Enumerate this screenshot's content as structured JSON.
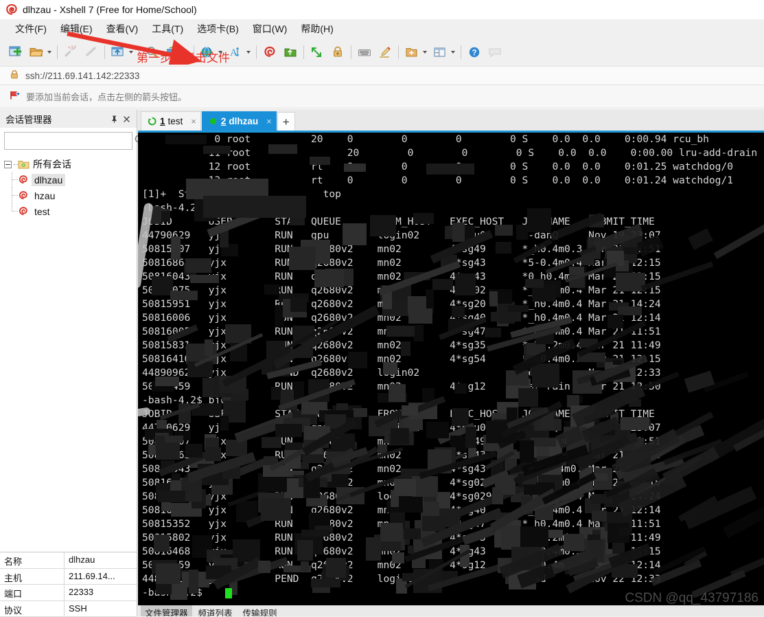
{
  "window": {
    "title": "dlhzau - Xshell 7 (Free for Home/School)",
    "app_icon": "xshell-spiral-icon"
  },
  "menubar": {
    "items": [
      {
        "label": "文件(F)",
        "name": "menu-file"
      },
      {
        "label": "编辑(E)",
        "name": "menu-edit"
      },
      {
        "label": "查看(V)",
        "name": "menu-view"
      },
      {
        "label": "工具(T)",
        "name": "menu-tools"
      },
      {
        "label": "选项卡(B)",
        "name": "menu-tabs"
      },
      {
        "label": "窗口(W)",
        "name": "menu-window"
      },
      {
        "label": "帮助(H)",
        "name": "menu-help"
      }
    ]
  },
  "toolbar": {
    "icons": [
      "new-session-icon",
      "open-session-icon",
      "disconnect-icon",
      "reconnect-icon",
      "transfer-file-icon",
      "find-icon",
      "copy-paste-icon",
      "globe-icon",
      "font-size-icon",
      "xshell-icon",
      "xftp-icon",
      "fullscreen-icon",
      "lock-icon",
      "keyboard-icon",
      "highlight-icon",
      "new-folder-icon",
      "layout-icon",
      "help-icon",
      "chat-icon"
    ]
  },
  "address": {
    "lock_icon": "lock-icon",
    "url": "ssh://211.69.141.142:22333"
  },
  "hint": {
    "icon": "flag-icon",
    "text": "要添加当前会话，点击左侧的箭头按钮。"
  },
  "session_manager": {
    "title": "会话管理器",
    "pin_icon": "pin-icon",
    "close_icon": "close-icon",
    "search": {
      "value": "",
      "placeholder": "",
      "icon": "search-icon"
    },
    "root": {
      "label": "所有会话",
      "icon": "folder-icon"
    },
    "sessions": [
      {
        "label": "dlhzau",
        "icon": "xshell-session-icon",
        "selected": true
      },
      {
        "label": "hzau",
        "icon": "xshell-session-icon",
        "selected": false
      },
      {
        "label": "test",
        "icon": "xshell-session-icon",
        "selected": false
      }
    ]
  },
  "properties": {
    "rows": [
      {
        "key": "名称",
        "value": "dlhzau"
      },
      {
        "key": "主机",
        "value": "211.69.14..."
      },
      {
        "key": "端口",
        "value": "22333"
      },
      {
        "key": "协议",
        "value": "SSH"
      }
    ]
  },
  "tabs": {
    "items": [
      {
        "num": "1",
        "name": "test",
        "icon": "reconnect-icon",
        "active": false,
        "close": "×"
      },
      {
        "num": "2",
        "name": "dlhzau",
        "icon": "connected-dot-icon",
        "active": true,
        "close": "×"
      }
    ],
    "add_label": "+"
  },
  "terminal": {
    "lines": [
      "            0 root          20    0        0        0        0 S    0.0  0.0    0:00.94 rcu_bh",
      "           11 root                20        0        0        0 S    0.0  0.0    0:00.00 lru-add-drain",
      "           12 root          rt    0        0        0        0 S    0.0  0.0    0:01.25 watchdog/0",
      "           13 root          rt    0        0        0        0 S    0.0  0.0    0:01.24 watchdog/1",
      "[1]+  Stopped                 top",
      "-bash-4.2$ bjobs",
      "JOBID      USER       STAT  QUEUE      FROM_HOST   EXEC_HOST   JOB_NAME   SUBMIT_TIME",
      "44790629   yjx        RUN   gpu        login02     4*gpu02     8-danQ     Nov 19 23:07",
      "50815807   yjx        RUN   q2680v2    mn02        4*sg49      *_h0.4m0.3 Mar 21 11:51",
      "50816863   yjx        RUN   q2680v2    mn02        4*sg43      *5-0.4m0.4 Mar 21 12:15",
      "50816043   yjx        RUN   q2680v2    mn02        4*sg43      *0_h0.4m0. Mar 21 12:15",
      "50816075   yjx        RUN   q2680v2    mn02        4*sg02      *_0.02m0.4 Mar 21 12:15",
      "50815951   yjx        RUN   q2680v2    mn02        4*sg20      *_h0.4m0.4 Mar 21 14:24",
      "50816006   yjx        RUN   q2680v2    mn02        4*sg40      *_h0.4m0.4 Mar 21 12:14",
      "50816005   yjx        RUN   q2680v2    mn02        4*sg47      *_h0.4m0.4 Mar 21 11:51",
      "50815831   yjx        RUN   q2680v2    mn02        4*sg35      *_h0.2m0.4 Mar 21 11:49",
      "50816410   yjx        RUN   q2680v2    mn02        4*sg54      *5-0.4m0.3 Mar 21 12:15",
      "44890962   yjx        PEND  q2680v2    login02                 read       Nov 22 12:33",
      "50816459   yjx        RUN   q2680v2    mn02        4*sg12      ear rain   Mar 21 12:50",
      "-bash-4.2$ bjobs",
      "JOBID      USER       STAT  QUEUE      FROM_HOST   EXEC_HOST   JOB_NAME   SUBMIT_TIME",
      "44790629   yjx        RUN   gpu        login02     4*gpu02     8-danQ     Nov 19 23:07",
      "50815807   yjx        RUN   q2680v2    mn02        4*sg49      *_h0.4m0.3 Mar 21 11:51",
      "50816863   yjx        RUN   q2680v2    mn02        4*sg43      *5-0.4m0.4 Mar 21 12:15",
      "50816043   yjx        RUN   q2680v2    mn02        4*sg43      *0_h0.4m0. Mar 21 12:15",
      "50816075   yjx        RUN   q2680v2    mn02        4*sg02      *_0.02m0.4 Mar 21 12:15",
      "50826091   yjx        RUN   q2680v2    login02     4*sg029     *_h0.4m0.4 Mar 21 14:24",
      "50816812   yjx        RUN   q2680v2    mn02        4*sg40      *_h0.4m0.4 Mar 21 12:14",
      "50815352   yjx        RUN   q2680v2    mn02        4*sg47      *_h0.4m0.4 Mar 21 11:51",
      "50815802   yjx        RUN   q2680v2    mn02        4*sg35      *_h0.2m0.4 Mar 21 11:49",
      "50816468   yjx        RUN   q2680v2    mn02        4*sg43      *5-0.4m0.3 Mar 21 12:15",
      "50816459   yjx        RUN   q2680v2    mn02        4*sg12      *_h0.4m0.4 Mar 21 12:14",
      "44890962   yjx        PEND  q2680v2    login02                 read       Nov 22 12:33",
      "-bash-4.2$ "
    ],
    "prompt": "-bash-4.2$",
    "cursor": "block-cursor"
  },
  "bottom_tabs": {
    "items": [
      {
        "label": "文件管理器",
        "active": true
      },
      {
        "label": "频道列表",
        "active": false
      },
      {
        "label": "传输规则",
        "active": false
      }
    ]
  },
  "annotation": {
    "text": "第一步：点击文件",
    "color": "#e8332a",
    "arrow": "red-arrow-icon"
  },
  "watermark": {
    "text": "CSDN @qq_43797186"
  }
}
